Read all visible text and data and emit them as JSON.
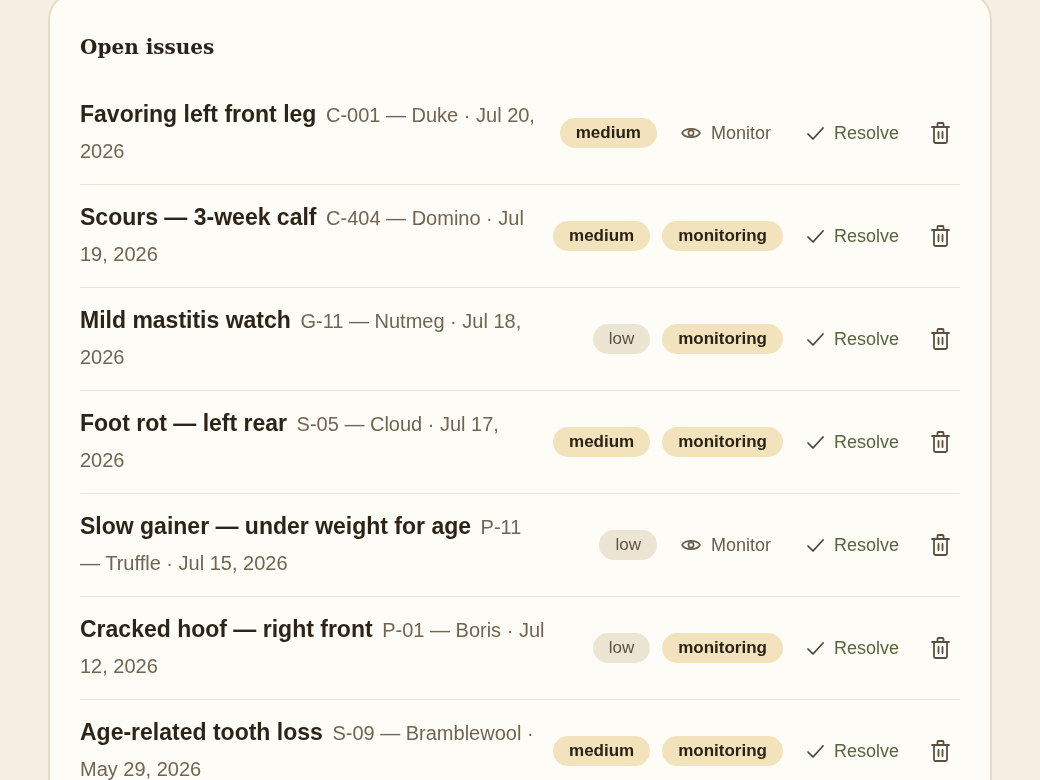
{
  "card": {
    "title": "Open issues"
  },
  "issues": [
    {
      "title": "Favoring left front leg",
      "meta": "C-001 — Duke · Jul 20, 2026",
      "severity": {
        "label": "medium",
        "kind": "medium"
      },
      "status": {
        "kind": "button",
        "label": "Monitor"
      },
      "resolve": "Resolve"
    },
    {
      "title": "Scours — 3-week calf",
      "meta": "C-404 — Domino · Jul 19, 2026",
      "severity": {
        "label": "medium",
        "kind": "medium"
      },
      "status": {
        "kind": "tag",
        "label": "monitoring"
      },
      "resolve": "Resolve"
    },
    {
      "title": "Mild mastitis watch",
      "meta": "G-11 — Nutmeg · Jul 18, 2026",
      "severity": {
        "label": "low",
        "kind": "low"
      },
      "status": {
        "kind": "tag",
        "label": "monitoring"
      },
      "resolve": "Resolve"
    },
    {
      "title": "Foot rot — left rear",
      "meta": "S-05 — Cloud · Jul 17, 2026",
      "severity": {
        "label": "medium",
        "kind": "medium"
      },
      "status": {
        "kind": "tag",
        "label": "monitoring"
      },
      "resolve": "Resolve"
    },
    {
      "title": "Slow gainer — under weight for age",
      "meta": "P-11 — Truffle · Jul 15, 2026",
      "severity": {
        "label": "low",
        "kind": "low"
      },
      "status": {
        "kind": "button",
        "label": "Monitor"
      },
      "resolve": "Resolve"
    },
    {
      "title": "Cracked hoof — right front",
      "meta": "P-01 — Boris · Jul 12, 2026",
      "severity": {
        "label": "low",
        "kind": "low"
      },
      "status": {
        "kind": "tag",
        "label": "monitoring"
      },
      "resolve": "Resolve"
    },
    {
      "title": "Age-related tooth loss",
      "meta": "S-09 — Bramblewool · May 29, 2026",
      "severity": {
        "label": "medium",
        "kind": "medium"
      },
      "status": {
        "kind": "tag",
        "label": "monitoring"
      },
      "resolve": "Resolve"
    }
  ]
}
